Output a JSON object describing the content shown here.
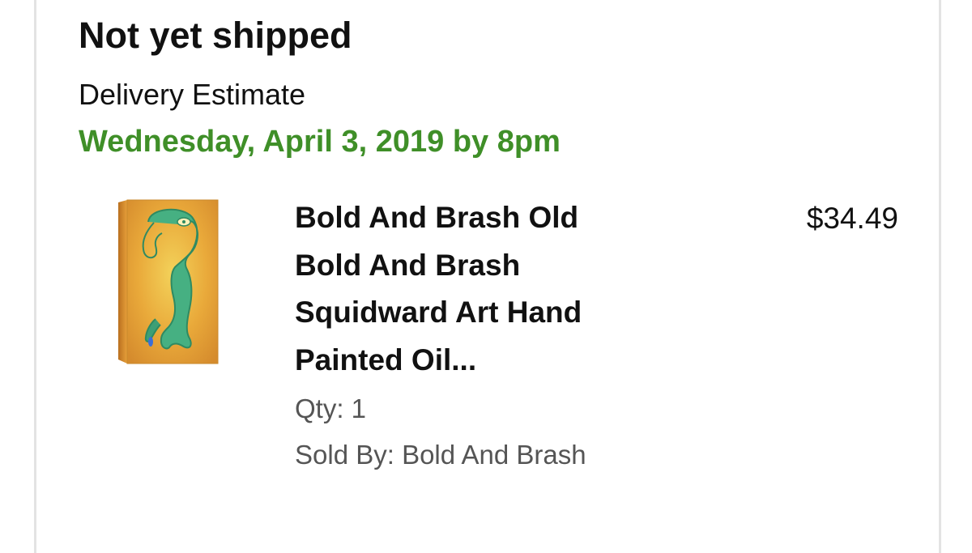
{
  "shipment": {
    "status": "Not yet shipped",
    "delivery_label": "Delivery Estimate",
    "delivery_date": "Wednesday, April 3, 2019 by 8pm"
  },
  "item": {
    "title_lines": [
      "Bold And Brash Old",
      "Bold And Brash",
      "Squidward Art Hand",
      "Painted Oil..."
    ],
    "price": "$34.49",
    "qty": "Qty: 1",
    "sold_by": "Sold By: Bold And Brash",
    "image": "product-painting-thumbnail"
  },
  "colors": {
    "delivery_date": "#3f8f28",
    "muted_text": "#555555",
    "card_border": "#e3e3e3"
  }
}
